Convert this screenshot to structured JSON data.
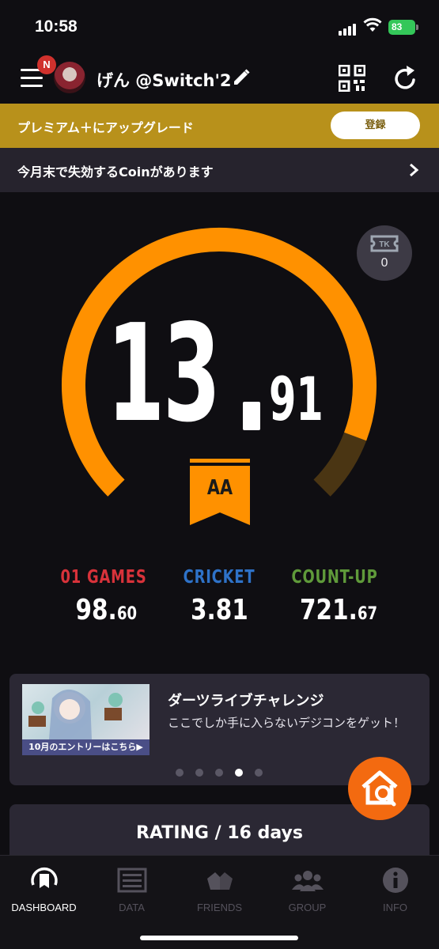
{
  "status_bar": {
    "time": "10:58",
    "battery": "83"
  },
  "header": {
    "notification_badge": "N",
    "username": "げん @Switch'2"
  },
  "premium": {
    "text": "プレミアム＋にアップグレード",
    "button": "登録"
  },
  "coin_notice": {
    "text": "今月末で失効するCoinがあります"
  },
  "gauge": {
    "ticket_count": "0",
    "rating_integer": "13",
    "rating_decimal": "91",
    "rank": "AA",
    "progress": 0.91,
    "colors": {
      "fill": "#ff9100",
      "track": "#4a3513"
    }
  },
  "stats": [
    {
      "label": "01 GAMES",
      "value_int": "98.",
      "value_dec": "60",
      "color": "#d8323a"
    },
    {
      "label": "CRICKET",
      "value_int": "3.81",
      "value_dec": "",
      "color": "#2e72c8"
    },
    {
      "label": "COUNT-UP",
      "value_int": "721.",
      "value_dec": "67",
      "color": "#5f9a3a"
    }
  ],
  "banner": {
    "image_caption": "10月のエントリーはこちら▶",
    "title": "ダーツライブチャレンジ",
    "description": "ここでしか手に入らないデジコンをゲット！",
    "dots": 5,
    "active_dot": 3
  },
  "rating_card": {
    "title": "RATING / 16 days"
  },
  "tabbar": {
    "tabs": [
      {
        "label": "DASHBOARD",
        "icon": "dashboard-icon",
        "active": true
      },
      {
        "label": "DATA",
        "icon": "data-icon",
        "active": false
      },
      {
        "label": "FRIENDS",
        "icon": "friends-icon",
        "active": false
      },
      {
        "label": "GROUP",
        "icon": "group-icon",
        "active": false
      },
      {
        "label": "INFO",
        "icon": "info-icon",
        "active": false
      }
    ]
  }
}
